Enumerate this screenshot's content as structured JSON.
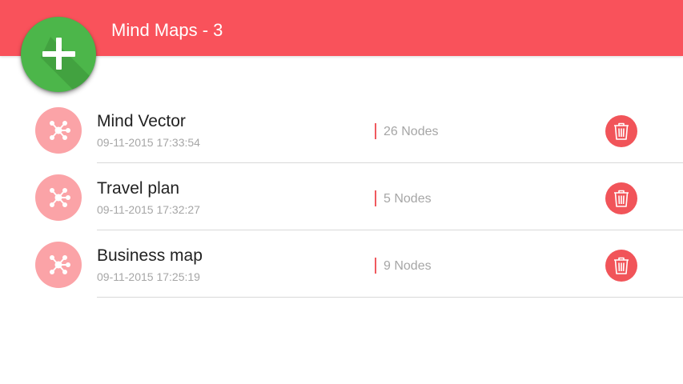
{
  "header": {
    "title": "Mind Maps - 3",
    "add_icon": "plus-icon"
  },
  "colors": {
    "header_bg": "#f9525b",
    "fab_bg": "#4cb64a",
    "map_icon_bg": "#fba3a7",
    "delete_bg": "#f15459",
    "accent_bar": "#f05a5f"
  },
  "maps": [
    {
      "title": "Mind Vector",
      "date": "09-11-2015 17:33:54",
      "nodes": "26 Nodes",
      "icon": "mind-map-icon",
      "delete_icon": "trash-icon"
    },
    {
      "title": "Travel plan",
      "date": "09-11-2015 17:32:27",
      "nodes": "5 Nodes",
      "icon": "mind-map-icon",
      "delete_icon": "trash-icon"
    },
    {
      "title": "Business map",
      "date": "09-11-2015 17:25:19",
      "nodes": "9 Nodes",
      "icon": "mind-map-icon",
      "delete_icon": "trash-icon"
    }
  ]
}
